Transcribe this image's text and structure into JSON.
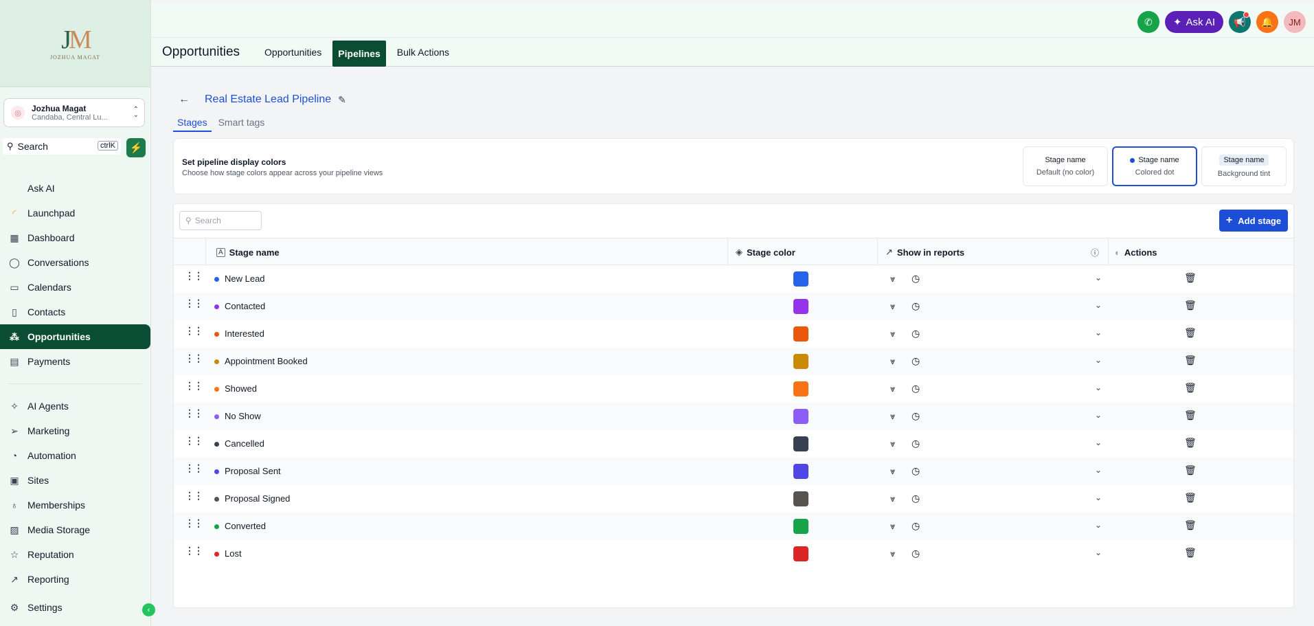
{
  "brand": {
    "logo_mark_j": "J",
    "logo_mark_m": "M",
    "logo_text": "JOZHUA MAGAT"
  },
  "account": {
    "name": "Jozhua Magat",
    "location": "Candaba, Central Lu..."
  },
  "sidebar_search": {
    "label": "Search",
    "shortcut": "ctrlK"
  },
  "nav": {
    "items": [
      {
        "label": "Ask AI",
        "icon": "none"
      },
      {
        "label": "Launchpad",
        "icon": "launchpad-icon"
      },
      {
        "label": "Dashboard",
        "icon": "dashboard-icon"
      },
      {
        "label": "Conversations",
        "icon": "chat-icon"
      },
      {
        "label": "Calendars",
        "icon": "calendar-icon"
      },
      {
        "label": "Contacts",
        "icon": "contacts-icon"
      },
      {
        "label": "Opportunities",
        "icon": "opportunities-icon",
        "active": true
      },
      {
        "label": "Payments",
        "icon": "payments-icon"
      }
    ],
    "items2": [
      {
        "label": "AI Agents",
        "icon": "sparkle-icon"
      },
      {
        "label": "Marketing",
        "icon": "send-icon"
      },
      {
        "label": "Automation",
        "icon": "automation-icon"
      },
      {
        "label": "Sites",
        "icon": "sites-icon"
      },
      {
        "label": "Memberships",
        "icon": "badge-icon"
      },
      {
        "label": "Media Storage",
        "icon": "image-icon"
      },
      {
        "label": "Reputation",
        "icon": "star-icon"
      },
      {
        "label": "Reporting",
        "icon": "trend-icon"
      }
    ],
    "settings": "Settings"
  },
  "topbar": {
    "ask_ai": "Ask AI",
    "avatar": "JM"
  },
  "subnav": {
    "title": "Opportunities",
    "tabs": [
      "Opportunities",
      "Pipelines",
      "Bulk Actions"
    ],
    "active_tab": "Pipelines"
  },
  "pipeline": {
    "title": "Real Estate Lead Pipeline",
    "tabs": [
      "Stages",
      "Smart tags"
    ],
    "active_tab": "Stages"
  },
  "display_colors": {
    "title": "Set pipeline display colors",
    "subtitle": "Choose how stage colors appear across your pipeline views",
    "options": [
      {
        "name": "Stage name",
        "desc": "Default (no color)"
      },
      {
        "name": "Stage name",
        "desc": "Colored dot"
      },
      {
        "name": "Stage name",
        "desc": "Background tint"
      }
    ],
    "selected": "Colored dot"
  },
  "table": {
    "search_placeholder": "Search",
    "add_button": "Add stage",
    "headers": {
      "name": "Stage name",
      "color": "Stage color",
      "reports": "Show in reports",
      "actions": "Actions"
    },
    "stages": [
      {
        "name": "New Lead",
        "color": "#2563eb"
      },
      {
        "name": "Contacted",
        "color": "#9333ea"
      },
      {
        "name": "Interested",
        "color": "#ea580c"
      },
      {
        "name": "Appointment Booked",
        "color": "#ca8a04"
      },
      {
        "name": "Showed",
        "color": "#f97316"
      },
      {
        "name": "No Show",
        "color": "#8b5cf6"
      },
      {
        "name": "Cancelled",
        "color": "#374151"
      },
      {
        "name": "Proposal Sent",
        "color": "#4f46e5"
      },
      {
        "name": "Proposal Signed",
        "color": "#57534e"
      },
      {
        "name": "Converted",
        "color": "#16a34a"
      },
      {
        "name": "Lost",
        "color": "#dc2626"
      }
    ]
  }
}
